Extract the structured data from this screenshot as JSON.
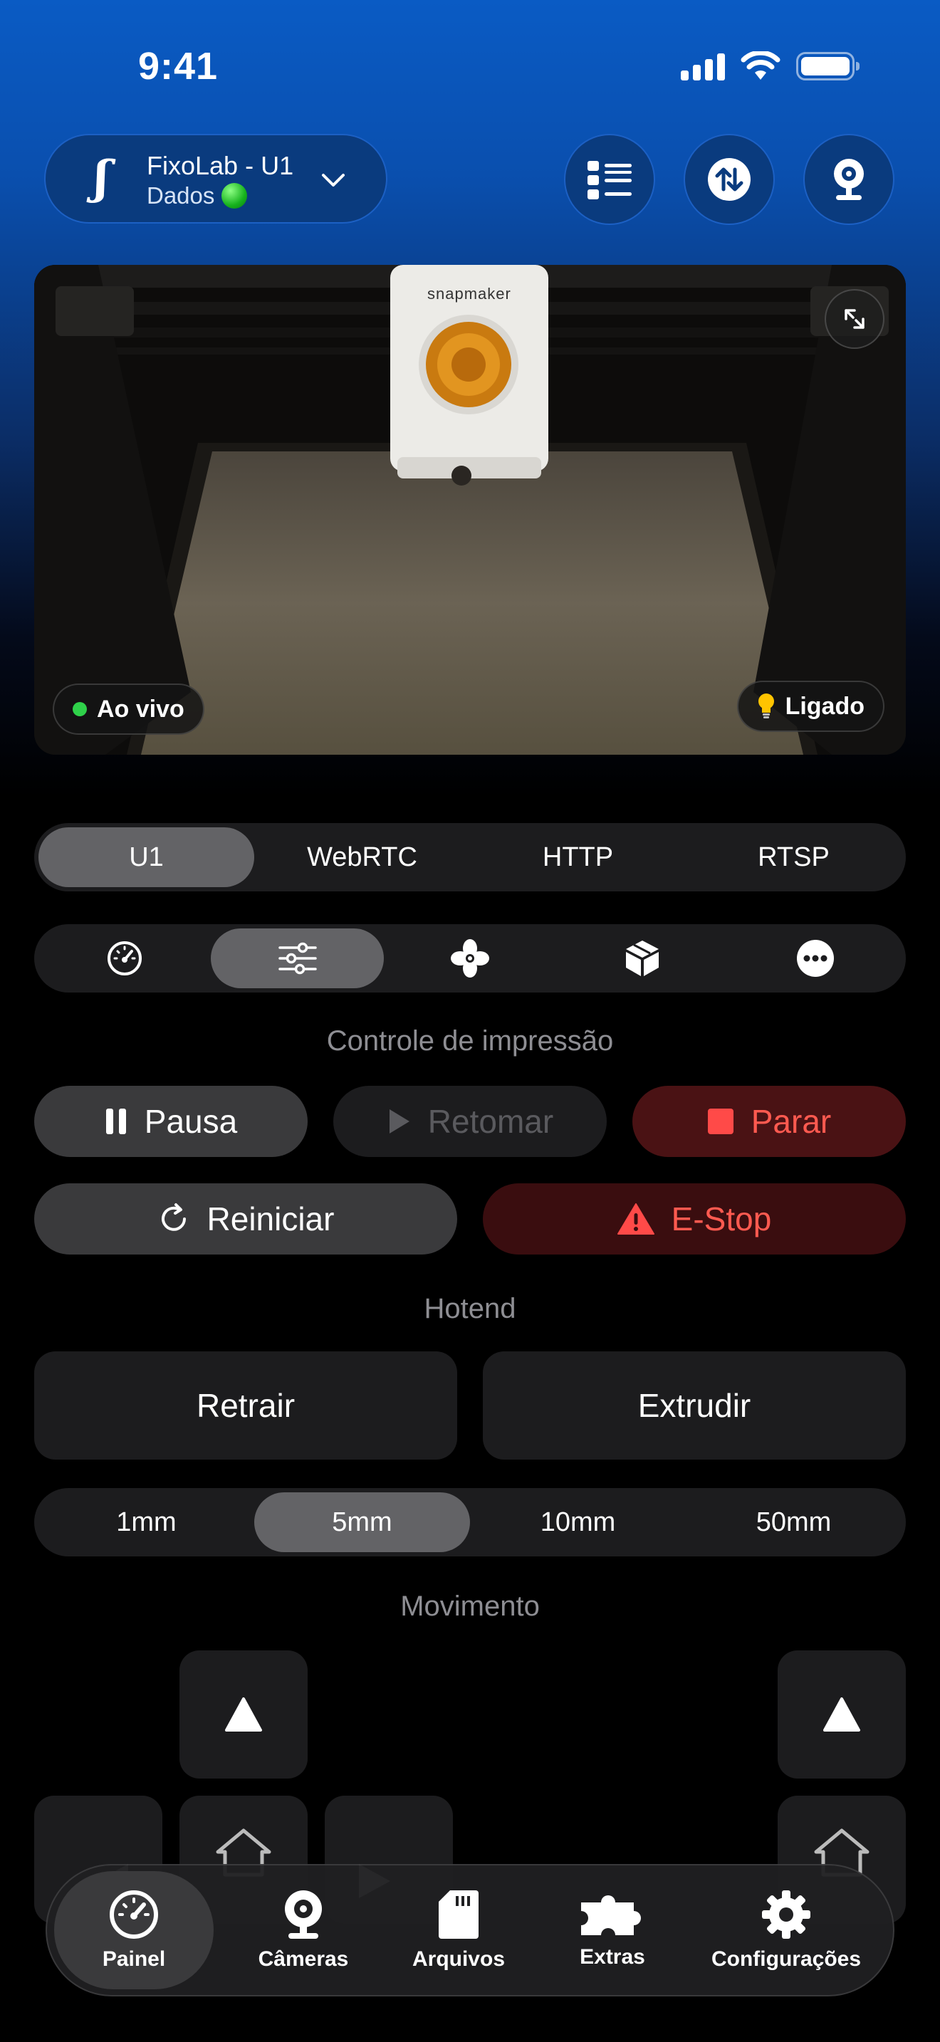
{
  "status_bar": {
    "time": "9:41"
  },
  "header": {
    "printer_name": "FixoLab - U1",
    "printer_status": "Dados",
    "logo_glyph": "ʃ"
  },
  "camera": {
    "live_label": "Ao vivo",
    "light_label": "Ligado",
    "brand_text": "snapmaker"
  },
  "stream_tabs": [
    "U1",
    "WebRTC",
    "HTTP",
    "RTSP"
  ],
  "stream_selected": "U1",
  "panel_tabs": [
    "speedometer-icon",
    "sliders-icon",
    "fan-icon",
    "cube-icon",
    "more-icon"
  ],
  "panel_selected": "sliders-icon",
  "print_control": {
    "title": "Controle de impressão",
    "pause": "Pausa",
    "resume": "Retomar",
    "stop": "Parar",
    "restart": "Reiniciar",
    "estop": "E-Stop"
  },
  "hotend": {
    "title": "Hotend",
    "retract": "Retrair",
    "extrude": "Extrudir",
    "distances": [
      "1mm",
      "5mm",
      "10mm",
      "50mm"
    ],
    "selected": "5mm"
  },
  "movement": {
    "title": "Movimento"
  },
  "tab_bar": [
    {
      "label": "Painel",
      "icon": "gauge-icon",
      "active": true
    },
    {
      "label": "Câmeras",
      "icon": "webcam-icon",
      "active": false
    },
    {
      "label": "Arquivos",
      "icon": "sd-card-icon",
      "active": false
    },
    {
      "label": "Extras",
      "icon": "puzzle-icon",
      "active": false
    },
    {
      "label": "Configurações",
      "icon": "gear-icon",
      "active": false
    }
  ],
  "colors": {
    "accent_blue": "#0a3b7e",
    "danger_red": "#ff5a50",
    "live_green": "#2fd14a"
  }
}
